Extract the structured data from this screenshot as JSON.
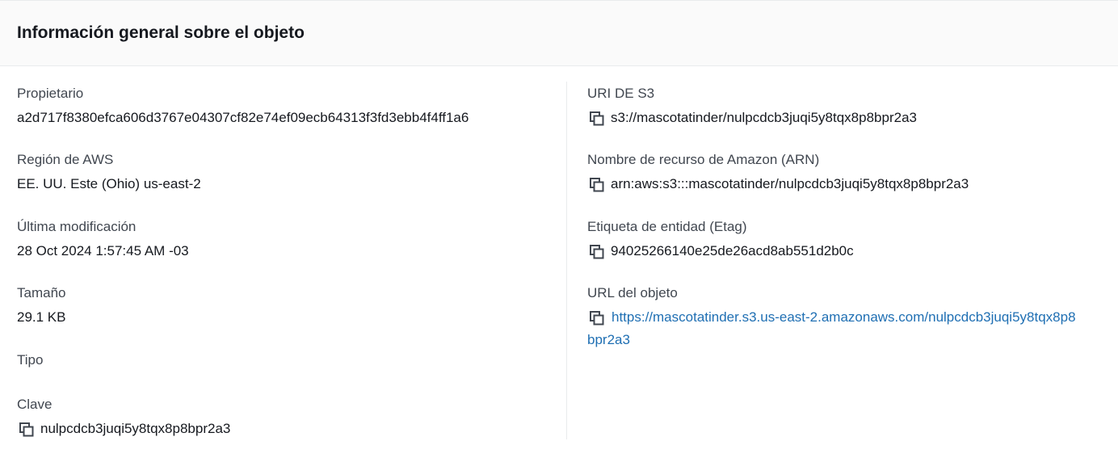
{
  "header": {
    "title": "Información general sobre el objeto"
  },
  "left": {
    "owner": {
      "label": "Propietario",
      "value": "a2d717f8380efca606d3767e04307cf82e74ef09ecb64313f3fd3ebb4f4ff1a6"
    },
    "region": {
      "label": "Región de AWS",
      "value": "EE. UU. Este (Ohio) us-east-2"
    },
    "last_modified": {
      "label": "Última modificación",
      "value": "28 Oct 2024 1:57:45 AM -03"
    },
    "size": {
      "label": "Tamaño",
      "value": "29.1 KB"
    },
    "type": {
      "label": "Tipo",
      "value": ""
    },
    "key": {
      "label": "Clave",
      "value": "nulpcdcb3juqi5y8tqx8p8bpr2a3",
      "icon": "copy-icon"
    }
  },
  "right": {
    "s3_uri": {
      "label": "URI DE S3",
      "value": "s3://mascotatinder/nulpcdcb3juqi5y8tqx8p8bpr2a3",
      "icon": "copy-icon"
    },
    "arn": {
      "label": "Nombre de recurso de Amazon (ARN)",
      "value": "arn:aws:s3:::mascotatinder/nulpcdcb3juqi5y8tqx8p8bpr2a3",
      "icon": "copy-icon"
    },
    "etag": {
      "label": "Etiqueta de entidad (Etag)",
      "value": "94025266140e25de26acd8ab551d2b0c",
      "icon": "copy-icon"
    },
    "object_url": {
      "label": "URL del objeto",
      "value_line1": "https://mascotatinder.s3.us-east-2.amazonaws.com/nulpcdcb3juqi5y8tqx8p8",
      "value_line2": "bpr2a3",
      "icon": "copy-icon"
    }
  },
  "colors": {
    "header_bg": "#fafafa",
    "text": "#16191f",
    "label": "#414750",
    "link": "#1f6fb3",
    "divider": "#e9ebed"
  }
}
